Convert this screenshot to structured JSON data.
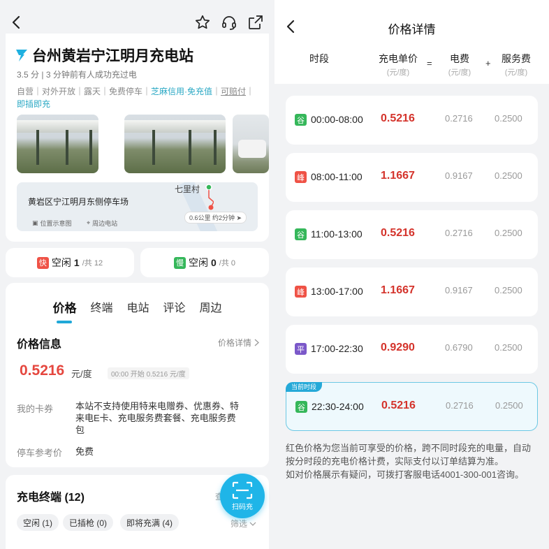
{
  "colors": {
    "accent": "#20a8d8",
    "price_red": "#d4332b",
    "peak_red": "#ef5246",
    "valley_green": "#35b75a",
    "flat_purple": "#7b58c9"
  },
  "left": {
    "topbar": {
      "icons": [
        "back-icon",
        "star-icon",
        "headset-icon",
        "share-icon"
      ]
    },
    "station": {
      "name": "台州黄岩宁江明月充电站",
      "rating": "3.5 分",
      "recent": "3 分钟前有人成功充过电",
      "tags_plain": "自营｜对外开放｜露天｜免费停车｜",
      "tags_highlight": "芝麻信用·免充值",
      "tags_sep": "｜",
      "tags_underline": "可赔付",
      "tags_sep2": "｜",
      "tags_tail": "即插即充",
      "map": {
        "place": "黄岩区宁江明月东侧停车场",
        "village": "七里村",
        "distance": "0.6公里 约2分钟",
        "link_position": "位置示意图",
        "link_nearby": "周边电站"
      }
    },
    "slots": {
      "fast": {
        "badge": "快",
        "label": "空闲 ",
        "free": "1",
        "total": "/共 12"
      },
      "slow": {
        "badge": "慢",
        "label": "空闲 ",
        "free": "0",
        "total": "/共 0"
      }
    },
    "tabs": [
      "价格",
      "终端",
      "电站",
      "评论",
      "周边"
    ],
    "price_info": {
      "title": "价格信息",
      "detail_link": "价格详情",
      "price": "0.5216",
      "unit": "元/度",
      "note": "00:00 开始 0.5216 元/度",
      "card_label": "我的卡券",
      "card_value": "本站不支持使用特来电赠券、优惠券、特来电E卡、充电服务费套餐、充电服务费包",
      "parking_label": "停车参考价",
      "parking_value": "免费"
    },
    "terminals": {
      "title": "充电终端 (12)",
      "more": "查",
      "chips": [
        "空闲 (1)",
        "已插枪 (0)",
        "即将充满 (4)"
      ],
      "filter": "筛选",
      "scan_label": "扫码充"
    }
  },
  "right": {
    "title": "价格详情",
    "headers": {
      "period": "时段",
      "total": "充电单价",
      "total_unit": "(元/度)",
      "eq": "=",
      "energy": "电费",
      "energy_unit": "(元/度)",
      "plus": "+",
      "service": "服务费",
      "service_unit": "(元/度)"
    },
    "current_tag": "当前时段",
    "rows": [
      {
        "badge": "谷",
        "type": "valley",
        "time": "00:00-08:00",
        "total": "0.5216",
        "energy": "0.2716",
        "service": "0.2500"
      },
      {
        "badge": "峰",
        "type": "peak",
        "time": "08:00-11:00",
        "total": "1.1667",
        "energy": "0.9167",
        "service": "0.2500"
      },
      {
        "badge": "谷",
        "type": "valley",
        "time": "11:00-13:00",
        "total": "0.5216",
        "energy": "0.2716",
        "service": "0.2500"
      },
      {
        "badge": "峰",
        "type": "peak",
        "time": "13:00-17:00",
        "total": "1.1667",
        "energy": "0.9167",
        "service": "0.2500"
      },
      {
        "badge": "平",
        "type": "flat",
        "time": "17:00-22:30",
        "total": "0.9290",
        "energy": "0.6790",
        "service": "0.2500"
      },
      {
        "badge": "谷",
        "type": "valley",
        "time": "22:30-24:00",
        "total": "0.5216",
        "energy": "0.2716",
        "service": "0.2500"
      }
    ],
    "notes": [
      "红色价格为您当前可享受的价格，跨不同时段充的电量，自动按分时段的充电价格计费，实际支付以订单结算为准。",
      "如对价格展示有疑问，可拨打客服电话4001-300-001咨询。"
    ]
  }
}
